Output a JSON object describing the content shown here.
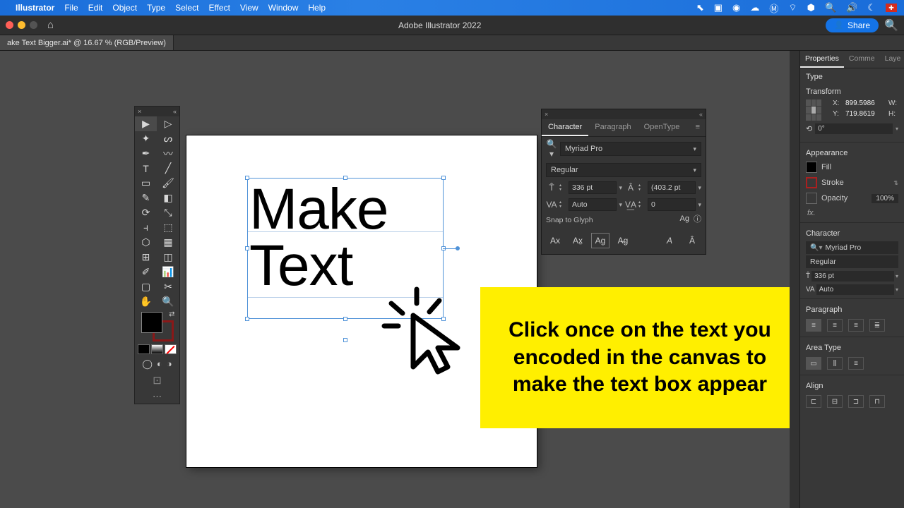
{
  "menubar": {
    "app": "Illustrator",
    "items": [
      "File",
      "Edit",
      "Object",
      "Type",
      "Select",
      "Effect",
      "View",
      "Window",
      "Help"
    ]
  },
  "app_header": {
    "title": "Adobe Illustrator 2022",
    "share": "Share"
  },
  "doc_tab": "ake Text Bigger.ai* @ 16.67 % (RGB/Preview)",
  "canvas_text": {
    "line1": "Make",
    "line2": "Text"
  },
  "callout": "Click once on the text you encoded in the canvas to make the text box appear",
  "char_panel": {
    "tabs": [
      "Character",
      "Paragraph",
      "OpenType"
    ],
    "font": "Myriad Pro",
    "style": "Regular",
    "size": "336 pt",
    "leading": "(403.2 pt",
    "kerning": "Auto",
    "tracking": "0",
    "snap_label": "Snap to Glyph"
  },
  "props": {
    "tabs": [
      "Properties",
      "Comme",
      "Laye"
    ],
    "type_label": "Type",
    "transform_label": "Transform",
    "x_label": "X:",
    "x_val": "899.5986",
    "y_label": "Y:",
    "y_val": "719.8619",
    "w_label": "W:",
    "h_label": "H:",
    "rot": "0°",
    "appearance_label": "Appearance",
    "fill_label": "Fill",
    "stroke_label": "Stroke",
    "opacity_label": "Opacity",
    "opacity_val": "100%",
    "fx": "fx.",
    "char_label": "Character",
    "font": "Myriad Pro",
    "style": "Regular",
    "size": "336 pt",
    "leading": "Auto",
    "para_label": "Paragraph",
    "area_label": "Area Type",
    "align_label": "Align"
  }
}
